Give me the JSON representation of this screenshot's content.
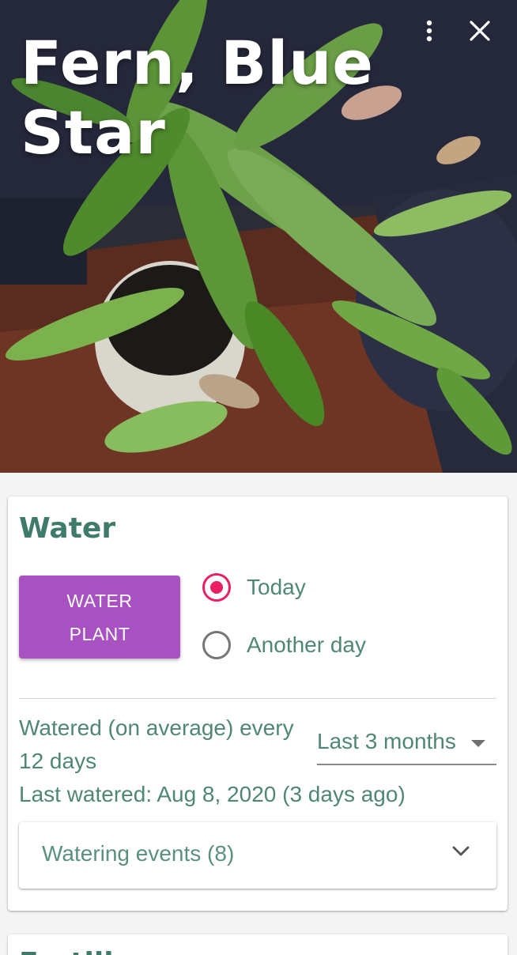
{
  "plant": {
    "name": "Fern, Blue Star"
  },
  "header": {
    "more_icon": "more-vert-icon",
    "close_icon": "close-icon"
  },
  "water": {
    "title": "Water",
    "button_label": "WATER PLANT",
    "options": [
      {
        "label": "Today",
        "checked": true
      },
      {
        "label": "Another day",
        "checked": false
      }
    ],
    "average_text": "Watered (on average) every 12 days",
    "period_select": {
      "value": "Last 3 months",
      "icon": "dropdown-arrow-icon"
    },
    "last_watered": "Last watered: Aug 8, 2020 (3 days ago)",
    "events_label": "Watering events (8)",
    "events_icon": "chevron-down-icon"
  },
  "next_section": {
    "title": "Fertilize"
  },
  "colors": {
    "accent_green": "#3f7a6a",
    "button_purple": "#a852c2",
    "radio_pink": "#e91e63"
  }
}
